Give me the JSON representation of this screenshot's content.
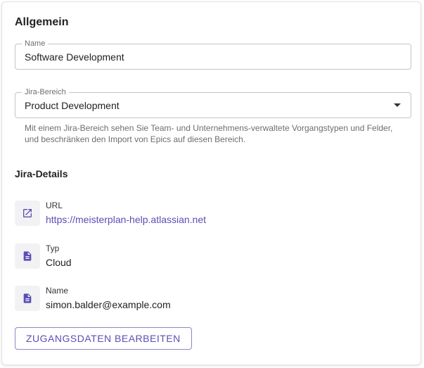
{
  "general": {
    "title": "Allgemein",
    "name_field": {
      "label": "Name",
      "value": "Software Development"
    },
    "area_field": {
      "label": "Jira-Bereich",
      "value": "Product Development"
    },
    "area_helper": "Mit einem Jira-Bereich sehen Sie Team- und Unternehmens-verwaltete Vorgangstypen und Felder, und beschränken den Import von Epics auf diesen Bereich."
  },
  "details": {
    "title": "Jira-Details",
    "items": [
      {
        "label": "URL",
        "value": "https://meisterplan-help.atlassian.net",
        "icon": "external-link-icon"
      },
      {
        "label": "Typ",
        "value": "Cloud",
        "icon": "document-icon"
      },
      {
        "label": "Name",
        "value": "simon.balder@example.com",
        "icon": "document-icon"
      }
    ]
  },
  "actions": {
    "edit_credentials_label": "ZUGANGSDATEN BEARBEITEN"
  },
  "colors": {
    "accent": "#5a4fb5",
    "border": "#c4c4c4",
    "icon_background": "#f2f2f4"
  }
}
